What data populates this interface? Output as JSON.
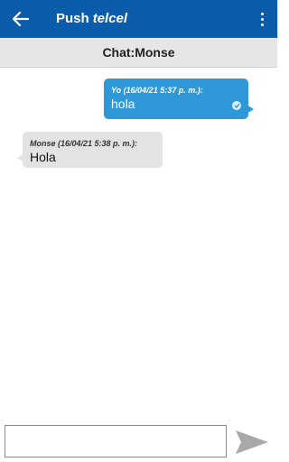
{
  "header": {
    "title_main": "Push",
    "title_brand": "telcel",
    "colors": {
      "bar": "#0b5cab"
    },
    "icons": {
      "back": "arrow-left-icon",
      "menu": "more-vert-icon"
    }
  },
  "chat": {
    "title": "Chat:Monse",
    "messages": [
      {
        "sender_line": "Yo (16/04/21 5:37 p. m.):",
        "text": "hola",
        "outgoing": true,
        "status_icon": "check-icon"
      },
      {
        "sender_line": "Monse (16/04/21 5:38 p. m.):",
        "text": "Hola",
        "outgoing": false
      }
    ]
  },
  "composer": {
    "value": "",
    "placeholder": "",
    "send_icon": "send-icon"
  }
}
